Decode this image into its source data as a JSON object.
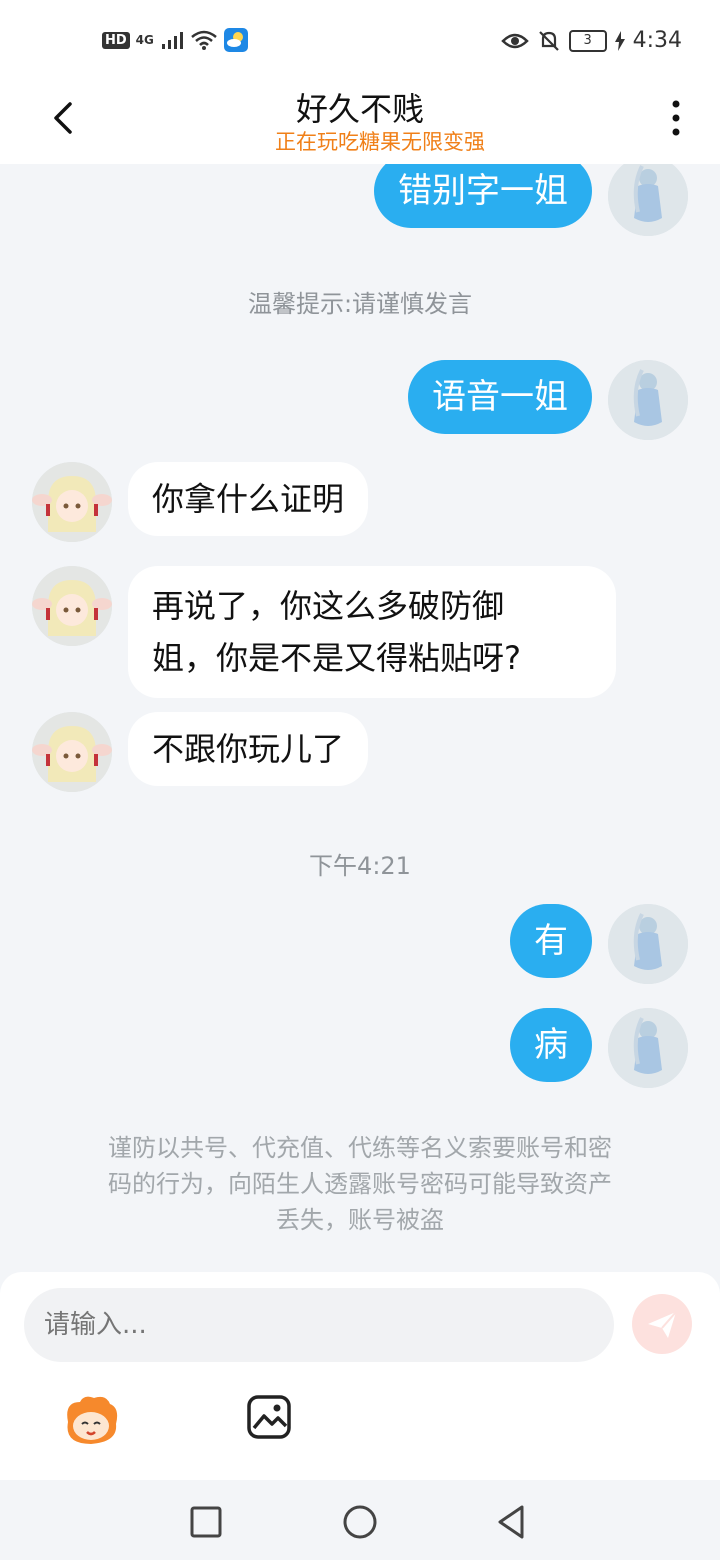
{
  "status_bar": {
    "network_badge": "HD",
    "network_type": "4G",
    "battery_level": "3",
    "time": "4:34",
    "icons": [
      "signal-icon",
      "wifi-icon",
      "weather-icon",
      "eye-icon",
      "mute-icon",
      "charging-icon"
    ]
  },
  "header": {
    "title": "好久不贱",
    "subtitle": "正在玩吃糖果无限变强",
    "subtitle_color": "#f08019",
    "icons": [
      "back-arrow-icon",
      "more-vertical-icon"
    ]
  },
  "messages": {
    "m1": {
      "text": "错别字一姐",
      "side": "out"
    },
    "notice_tip": "温馨提示:请谨慎发言",
    "m2": {
      "text": "语音一姐",
      "side": "out"
    },
    "m3": {
      "text": "你拿什么证明",
      "side": "in"
    },
    "m4_line1": "再说了，你这么多破防御",
    "m4_line2": "姐，你是不是又得粘贴呀?",
    "m5": {
      "text": "不跟你玩儿了",
      "side": "in"
    },
    "timestamp": "下午4:21",
    "m6": {
      "text": "有",
      "side": "out"
    },
    "m7": {
      "text": "病",
      "side": "out"
    }
  },
  "warning": {
    "line1": "谨防以共号、代充值、代练等名义索要账号和密",
    "line2": "码的行为，向陌生人透露账号密码可能导致资产",
    "line3": "丢失，账号被盗"
  },
  "composer": {
    "placeholder": "请输入...",
    "icons": [
      "send-icon",
      "emoji-sticker-icon",
      "image-icon"
    ]
  },
  "nav_bar": {
    "icons": [
      "recent-apps-icon",
      "home-icon",
      "back-nav-icon"
    ]
  },
  "colors": {
    "accent_blue": "#2aaef0",
    "send_disabled": "#fde1de",
    "background": "#f3f5f8"
  }
}
